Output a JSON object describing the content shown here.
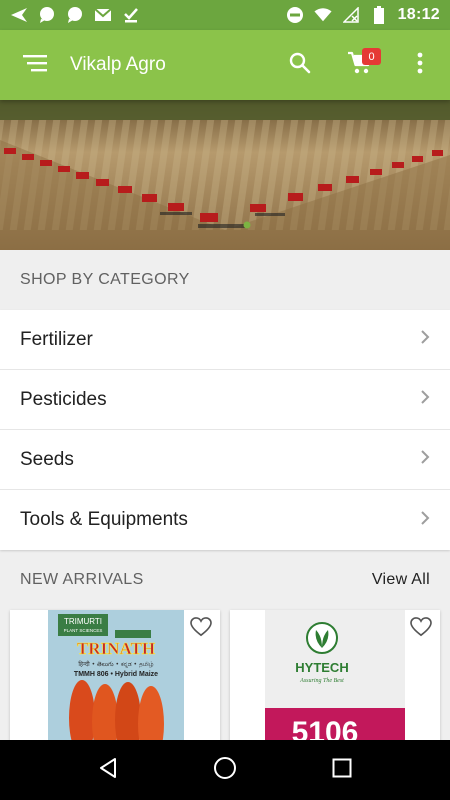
{
  "status_bar": {
    "time": "18:12",
    "left_icons": [
      "send-icon",
      "chat-bubble-icon",
      "chat-bubble-icon",
      "gmail-icon",
      "download-done-icon"
    ],
    "right_icons": [
      "do-not-disturb-icon",
      "wifi-icon",
      "signal-off-icon",
      "battery-icon"
    ]
  },
  "app_bar": {
    "title": "Vikalp Agro",
    "cart_count": "0"
  },
  "categories_section": {
    "heading": "SHOP BY CATEGORY",
    "items": [
      {
        "label": "Fertilizer"
      },
      {
        "label": "Pesticides"
      },
      {
        "label": "Seeds"
      },
      {
        "label": "Tools & Equipments"
      }
    ]
  },
  "new_arrivals": {
    "heading": "NEW ARRIVALS",
    "view_all": "View All",
    "products": [
      {
        "brand_top": "TRIMURTI",
        "brand_sub": "PLANT SCIENCES",
        "name": "TRINATH",
        "lang_line": "हिन्दी • తెలుగు • ಕನ್ನಡ • தமிழ்",
        "variety": "TMMH 806 • Hybrid Maize",
        "image_colors": [
          "#9fc7d8",
          "#d94a1c"
        ]
      },
      {
        "brand": "HYTECH",
        "tagline": "Assuring The Best",
        "code": "5106",
        "image_colors": [
          "#f4f4f4",
          "#c2185b"
        ]
      }
    ]
  },
  "colors": {
    "status_bar": "#6ca63f",
    "app_bar": "#8bc34a",
    "badge": "#e53935"
  }
}
